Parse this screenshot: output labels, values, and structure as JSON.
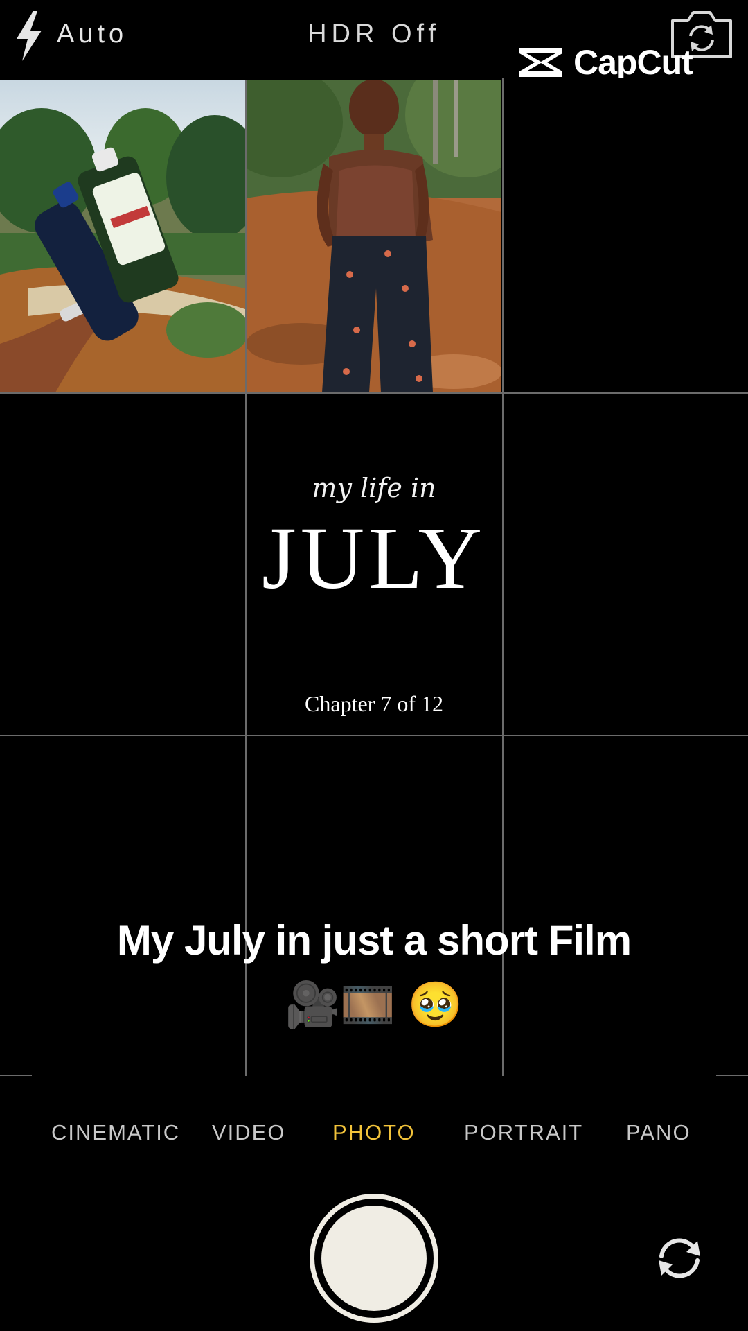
{
  "top_bar": {
    "flash_label": "Auto",
    "hdr_label": "HDR Off",
    "watermark": "CapCut",
    "icons": [
      "flash-icon",
      "switch-camera-icon",
      "capcut-logo-icon"
    ]
  },
  "overlay": {
    "script_line": "my life in",
    "month": "JULY",
    "chapter": "Chapter 7 of 12"
  },
  "caption": {
    "line1": "My July in just a short Film",
    "line2": "🎥🎞️ 🥹"
  },
  "modes": {
    "items": [
      "CINEMATIC",
      "VIDEO",
      "PHOTO",
      "PORTRAIT",
      "PANO"
    ],
    "selected": "PHOTO"
  },
  "colors": {
    "accent": "#f2c33a",
    "shutter": "#f0ede4",
    "grid": "#6b6b6b"
  }
}
